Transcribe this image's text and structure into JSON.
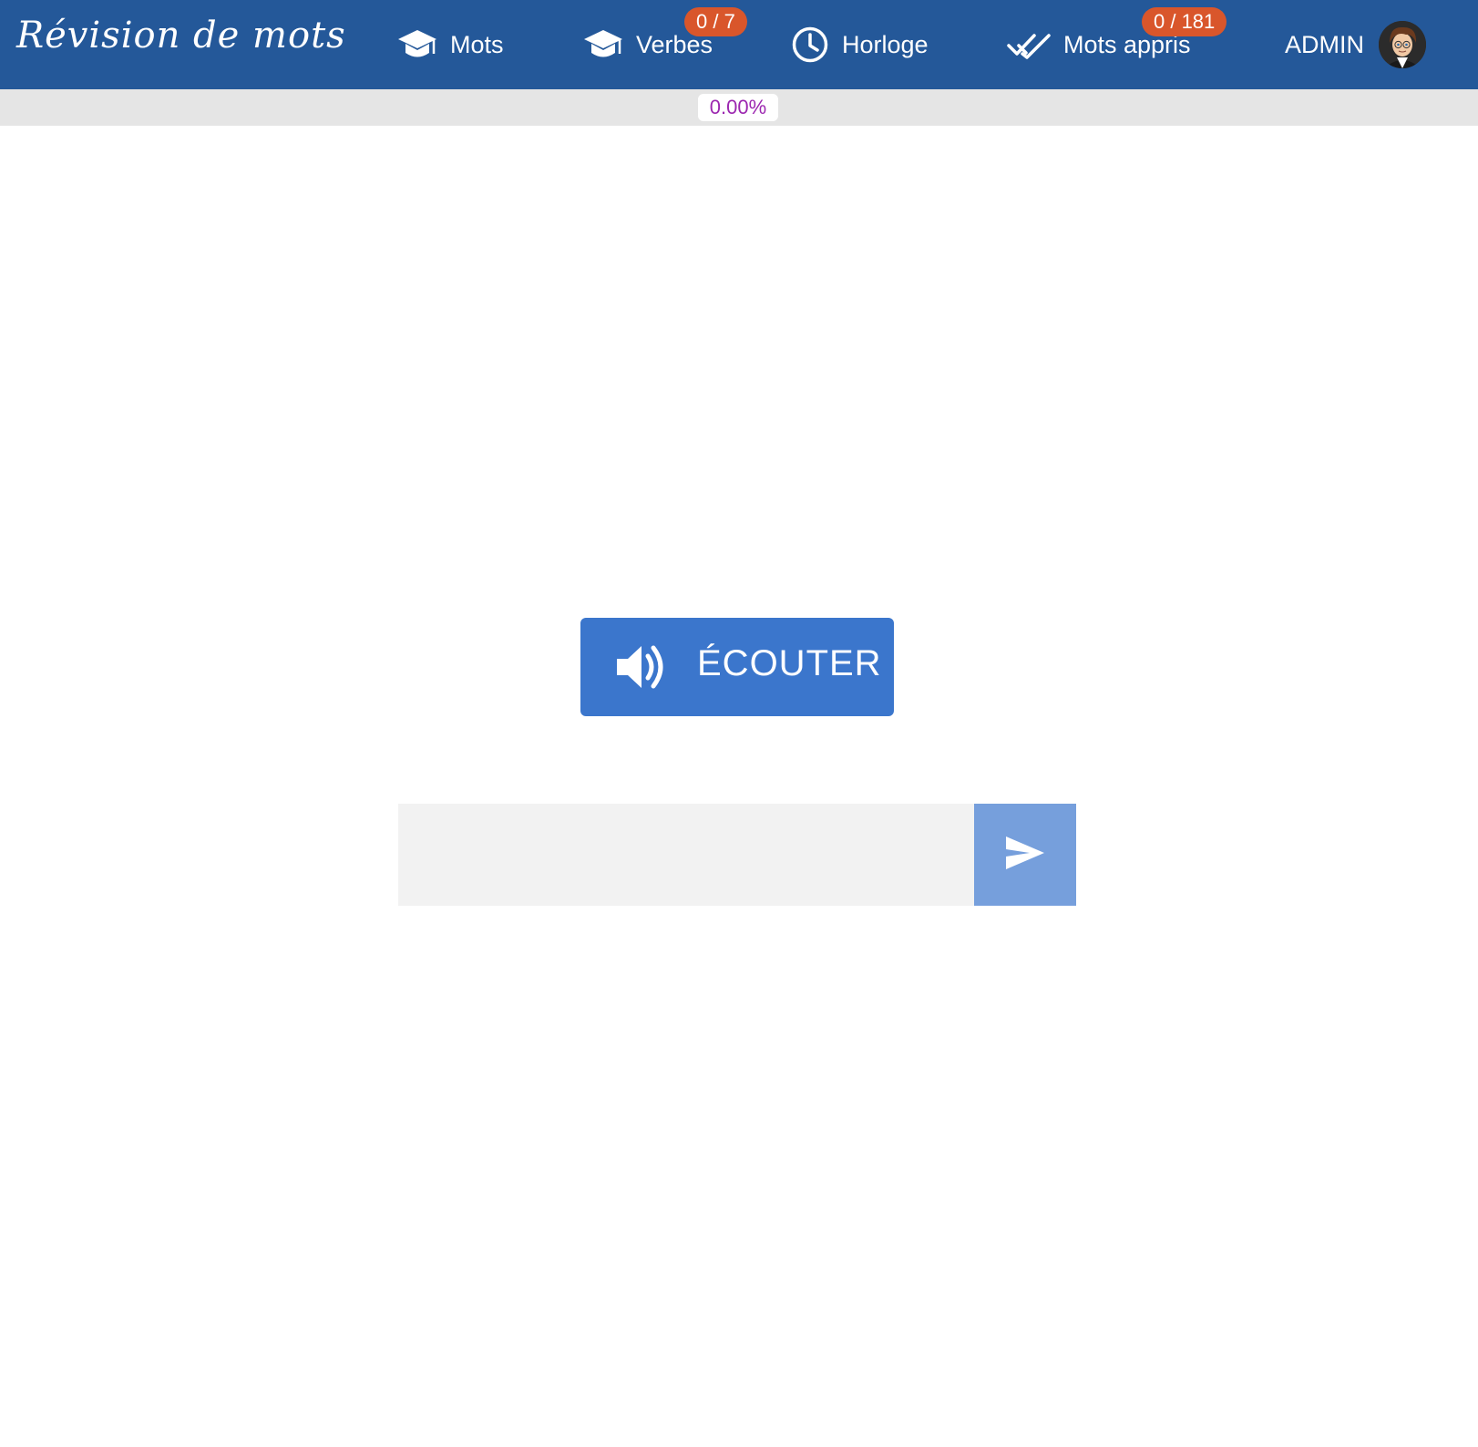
{
  "navbar": {
    "brand": "Révision de mots",
    "background": "#245899",
    "items": [
      {
        "label": "Mots",
        "icon": "graduation-cap-icon",
        "badge": null
      },
      {
        "label": "Verbes",
        "icon": "graduation-cap-icon",
        "badge": "0 / 7"
      },
      {
        "label": "Horloge",
        "icon": "clock-icon",
        "badge": null
      },
      {
        "label": "Mots appris",
        "icon": "double-check-icon",
        "badge": "0 / 181"
      }
    ],
    "user": {
      "label": "ADMIN",
      "avatar": "avatar-image"
    }
  },
  "progress": {
    "label": "0.00%",
    "value": 0
  },
  "main": {
    "listen_button": {
      "label": "ÉCOUTER",
      "icon": "speaker-icon",
      "color": "#3b76cc"
    },
    "answer": {
      "value": "",
      "placeholder": ""
    },
    "send_button": {
      "icon": "send-icon",
      "color": "#769fdc"
    }
  },
  "colors": {
    "badge": "#d9562b",
    "progress_text": "#9c27b0"
  }
}
